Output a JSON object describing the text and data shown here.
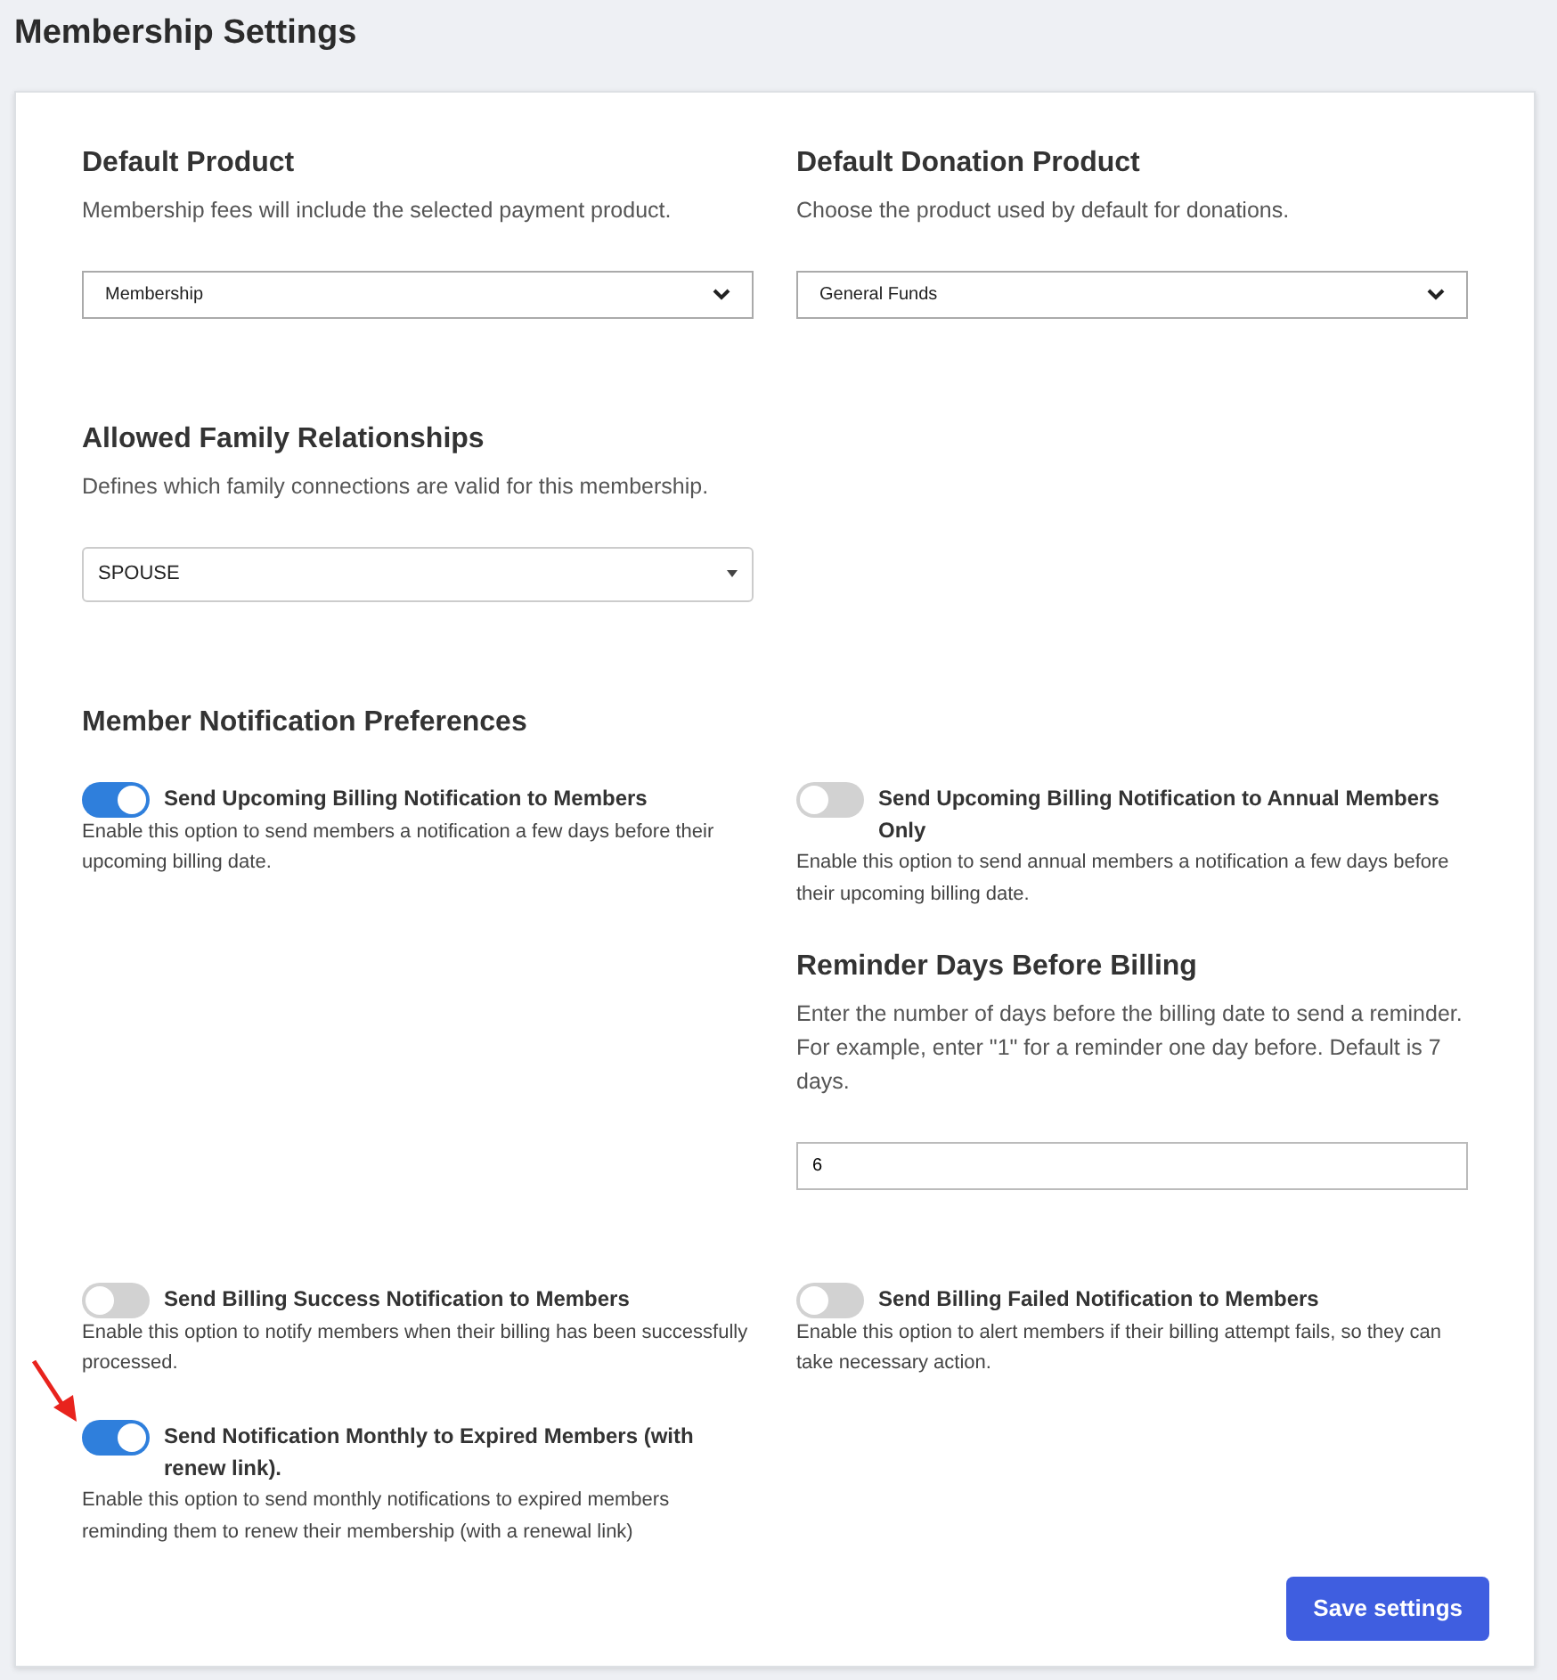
{
  "page_title": "Membership Settings",
  "select_rows": [
    {
      "fields": [
        {
          "heading": "Default Product",
          "description": "Membership fees will include the selected payment product.",
          "kind": "native",
          "value": "Membership"
        },
        {
          "heading": "Default Donation Product",
          "description": "Choose the product used by default for donations.",
          "kind": "native",
          "value": "General Funds"
        }
      ]
    },
    {
      "fields": [
        {
          "heading": "Allowed Family Relationships",
          "description": "Defines which family connections are valid for this membership.",
          "kind": "dropdown",
          "value": "SPOUSE"
        }
      ]
    }
  ],
  "notifications": {
    "heading": "Member Notification Preferences",
    "rows": [
      {
        "left": [
          {
            "kind": "toggle",
            "label": "Send Upcoming Billing Notification to Members",
            "description": "Enable this option to send members a notification a few days before their upcoming billing date.",
            "on": true
          }
        ],
        "right": [
          {
            "kind": "toggle",
            "label": "Send Upcoming Billing Notification to Annual Members Only",
            "description": "Enable this option to send annual members a notification a few days before their upcoming billing date.",
            "on": false
          },
          {
            "kind": "number_field",
            "heading": "Reminder Days Before Billing",
            "description": "Enter the number of days before the billing date to send a reminder. For example, enter \"1\" for a reminder one day before. Default is 7 days.",
            "value": "6"
          }
        ]
      },
      {
        "left": [
          {
            "kind": "toggle",
            "label": "Send Billing Success Notification to Members",
            "description": "Enable this option to notify members when their billing has been successfully processed.",
            "on": false
          },
          {
            "kind": "toggle",
            "label": "Send Notification Monthly to Expired Members (with renew link).",
            "description": "Enable this option to send monthly notifications to expired members reminding them to renew their membership (with a renewal link)",
            "on": true,
            "pointer": true
          }
        ],
        "right": [
          {
            "kind": "toggle",
            "label": "Send Billing Failed Notification to Members",
            "description": "Enable this option to alert members if their billing attempt fails, so they can take necessary action.",
            "on": false
          }
        ]
      }
    ]
  },
  "save_button": "Save settings"
}
